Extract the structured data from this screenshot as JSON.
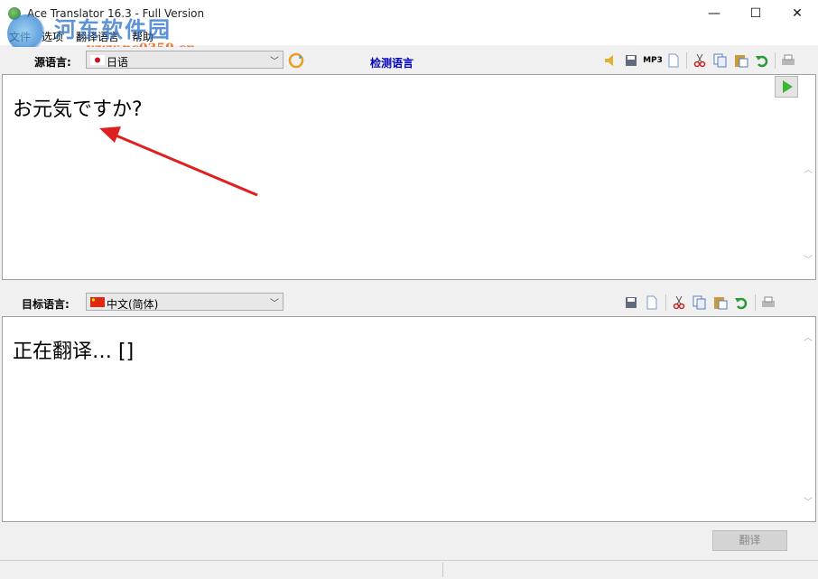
{
  "window": {
    "title": "Ace Translator 16.3 - Full Version",
    "minimize": "—",
    "maximize": "☐",
    "close": "✕"
  },
  "menu": [
    {
      "label": "文件"
    },
    {
      "label": "选项"
    },
    {
      "label": "翻译语言"
    },
    {
      "label": "帮助"
    }
  ],
  "watermark": {
    "name": "河东软件园",
    "url": "www.pc0359.cn"
  },
  "source": {
    "label": "源语言:",
    "language": "日语",
    "detect_label": "检测语言",
    "text": "お元気ですか?",
    "toolbar": [
      "speak-icon",
      "save-icon",
      "mp3-icon",
      "new-document-icon",
      "cut-icon",
      "copy-icon",
      "paste-icon",
      "undo-icon",
      "print-icon"
    ],
    "mp3_label": "MP3"
  },
  "target": {
    "label": "目标语言:",
    "language": "中文(简体)",
    "text": "正在翻译… []",
    "toolbar": [
      "save-icon",
      "new-document-icon",
      "cut-icon",
      "copy-icon",
      "paste-icon",
      "undo-icon",
      "print-icon"
    ]
  },
  "translate_button": "翻译",
  "colors": {
    "arrow": "#e02020",
    "detect_link": "#0000c0",
    "play": "#3ab83a"
  }
}
